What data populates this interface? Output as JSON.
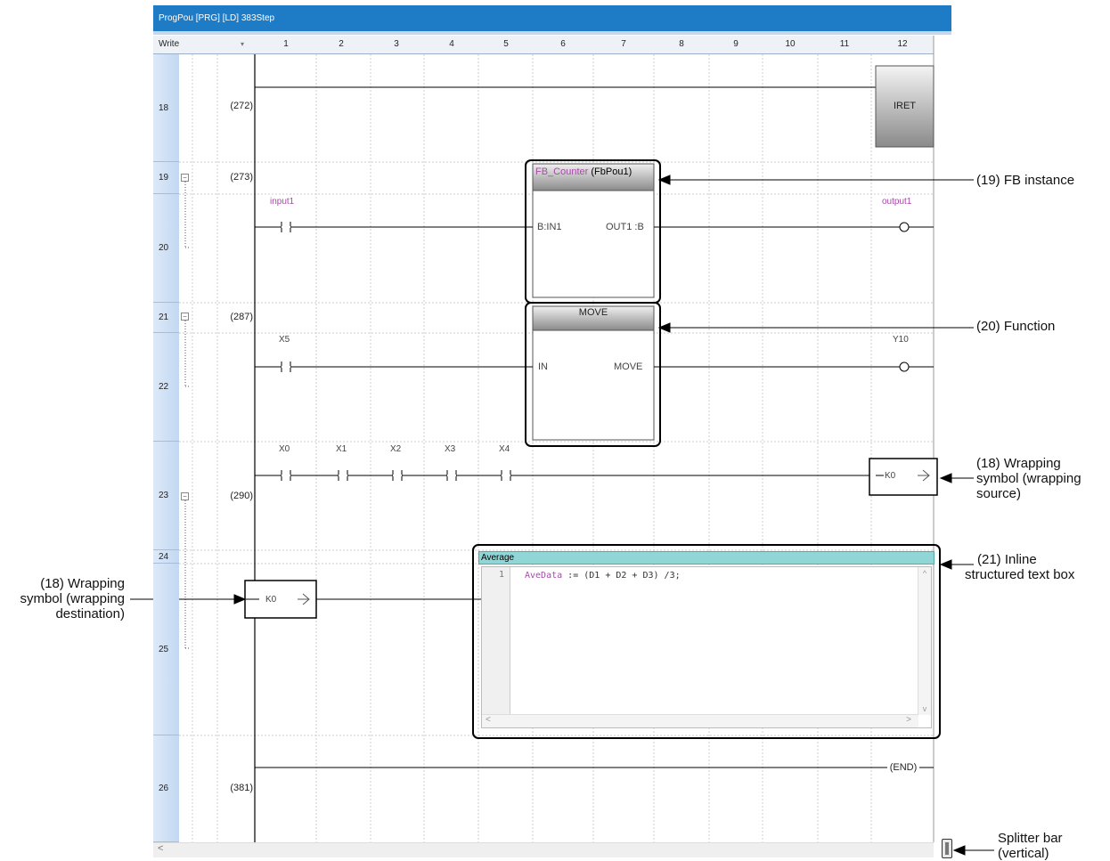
{
  "window": {
    "title": "ProgPou [PRG] [LD] 383Step"
  },
  "header": {
    "mode": "Write",
    "columns": [
      "1",
      "2",
      "3",
      "4",
      "5",
      "6",
      "7",
      "8",
      "9",
      "10",
      "11",
      "12"
    ]
  },
  "rows": [
    {
      "line": "18",
      "step": "(272)"
    },
    {
      "line": "19",
      "step": "(273)"
    },
    {
      "line": "20"
    },
    {
      "line": "21",
      "step": "(287)"
    },
    {
      "line": "22"
    },
    {
      "line": "23",
      "step": "(290)"
    },
    {
      "line": "24"
    },
    {
      "line": "25"
    },
    {
      "line": "26",
      "step": "(381)"
    }
  ],
  "ladder": {
    "iret": "IRET",
    "fb_type": "FB_Counter",
    "fb_instance": "(FbPou1)",
    "fb_input_pin": "B:IN1",
    "fb_output_pin": "OUT1 :B",
    "input1": "input1",
    "output1": "output1",
    "func_name": "MOVE",
    "func_in": "IN",
    "func_out": "MOVE",
    "contact_x5": "X5",
    "coil_y10": "Y10",
    "contacts_row23": [
      "X0",
      "X1",
      "X2",
      "X3",
      "X4"
    ],
    "wrap_label": "K0",
    "end": "END"
  },
  "inline_st": {
    "title": "Average",
    "line_no": "1",
    "code_var": "AveData",
    "code_rest": " := (D1 + D2 + D3) /3;"
  },
  "annotations": {
    "fb_instance": "(19) FB instance",
    "function": "(20) Function",
    "wrap_source": [
      "(18) Wrapping",
      "symbol (wrapping",
      "source)"
    ],
    "inline_st": [
      "(21) Inline",
      "structured text box"
    ],
    "wrap_dest": [
      "(18) Wrapping",
      "symbol (wrapping",
      "destination)"
    ],
    "splitter": [
      "Splitter bar",
      "(vertical)"
    ]
  },
  "colors": {
    "titlebar": "#1e7bc6",
    "variable": "#a64aa6",
    "st_title": "#90d6d6"
  }
}
